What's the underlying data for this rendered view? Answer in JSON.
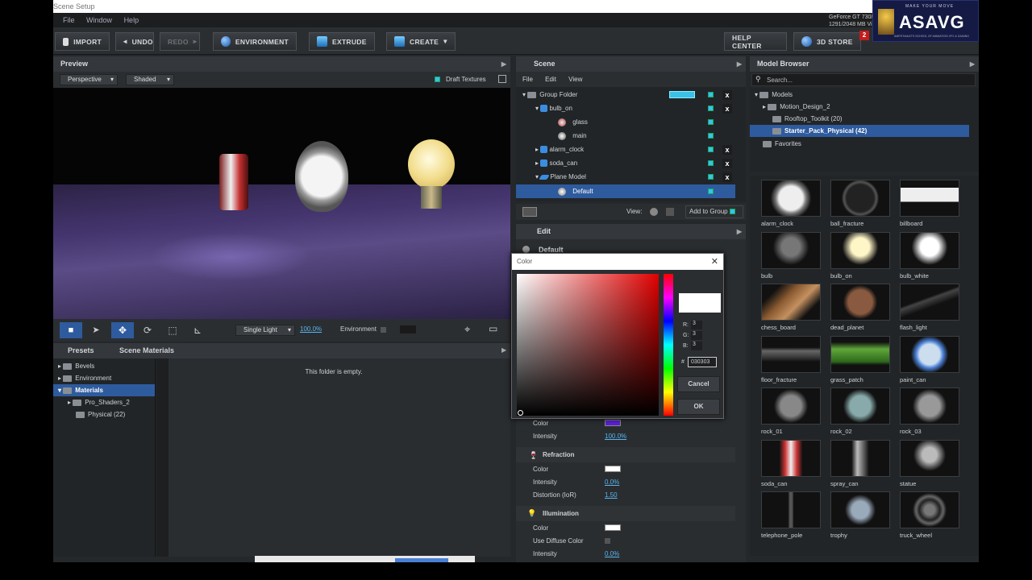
{
  "window_title": "Scene Setup",
  "menu": [
    "File",
    "Window",
    "Help"
  ],
  "gpu": {
    "name": "GeForce GT 730/PC",
    "mem": "1291/2048 MB Vi"
  },
  "toolbar": {
    "import": "IMPORT",
    "undo": "UNDO",
    "redo": "REDO",
    "environment": "ENVIRONMENT",
    "extrude": "EXTRUDE",
    "create": "CREATE",
    "help": "HELP CENTER",
    "store": "3D STORE",
    "store_badge": "2"
  },
  "watermark": {
    "logo": "ASAVG",
    "tagline": "MAKE YOUR MOVE",
    "sub": "AMRITHAKAT'S SCHOOL OF ANIMATION VFX & GAMING"
  },
  "preview": {
    "title": "Preview",
    "camera": "Perspective",
    "shading": "Shaded",
    "draft": "Draft Textures",
    "light": "Single Light",
    "light_pct": "100.0%",
    "environment": "Environment"
  },
  "presets": {
    "tab1": "Presets",
    "tab2": "Scene Materials",
    "empty": "This folder is empty.",
    "tree": [
      "Bevels",
      "Environment",
      "Materials",
      "Pro_Shaders_2",
      "Physical (22)"
    ]
  },
  "scene": {
    "title": "Scene",
    "menu": [
      "File",
      "Edit",
      "View"
    ],
    "rows": [
      {
        "label": "Group Folder"
      },
      {
        "label": "bulb_on"
      },
      {
        "label": "glass"
      },
      {
        "label": "main"
      },
      {
        "label": "alarm_clock"
      },
      {
        "label": "soda_can"
      },
      {
        "label": "Plane Model"
      },
      {
        "label": "Default"
      }
    ],
    "view_label": "View:",
    "add_group": "Add to Group"
  },
  "edit": {
    "title": "Edit",
    "material": "Default",
    "color_label": "Color",
    "intensity_label": "Intensity",
    "intensity_val": "100.0%",
    "refraction": "Refraction",
    "r_color": "Color",
    "r_intensity": "Intensity",
    "r_int_val": "0.0%",
    "r_distortion": "Distortion (IoR)",
    "r_dist_val": "1.50",
    "illumination": "Illumination",
    "i_color": "Color",
    "i_diffuse": "Use Diffuse Color",
    "i_intensity": "Intensity",
    "i_int_val": "0.0%"
  },
  "color_dialog": {
    "title": "Color",
    "r_label": "R:",
    "r": "3",
    "g_label": "G:",
    "g": "3",
    "b_label": "B:",
    "b": "3",
    "hash": "#",
    "hex": "030303",
    "cancel": "Cancel",
    "ok": "OK"
  },
  "model_browser": {
    "title": "Model Browser",
    "search": "Search...",
    "tree": [
      "Models",
      "Motion_Design_2",
      "Rooftop_Toolkit (20)",
      "Starter_Pack_Physical (42)",
      "Favorites"
    ],
    "items": [
      "alarm_clock",
      "ball_fracture",
      "billboard",
      "bulb",
      "bulb_on",
      "bulb_white",
      "chess_board",
      "dead_planet",
      "flash_light",
      "floor_fracture",
      "grass_patch",
      "paint_can",
      "rock_01",
      "rock_02",
      "rock_03",
      "soda_can",
      "spray_can",
      "statue",
      "telephone_pole",
      "trophy",
      "truck_wheel"
    ]
  },
  "colors": {
    "accent": "#2e5b9e",
    "check": "#3cc0e8",
    "purple": "#5a1fd6"
  }
}
